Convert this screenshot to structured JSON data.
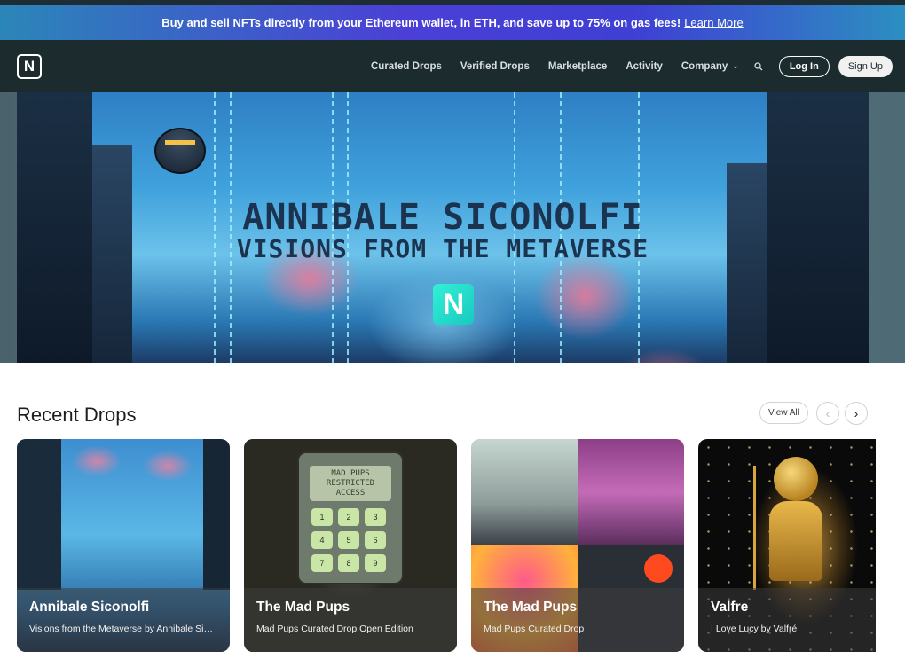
{
  "promo": {
    "text": "Buy and sell NFTs directly from your Ethereum wallet, in ETH, and save up to 75% on gas fees!",
    "link": "Learn More"
  },
  "nav": {
    "logo": "N",
    "links": [
      "Curated Drops",
      "Verified Drops",
      "Marketplace",
      "Activity"
    ],
    "company": "Company",
    "login": "Log In",
    "signup": "Sign Up"
  },
  "hero": {
    "title": "ANNIBALE SICONOLFI",
    "subtitle": "VISIONS FROM THE METAVERSE",
    "logo": "N"
  },
  "recent": {
    "title": "Recent Drops",
    "view_all": "View All",
    "prev": "‹",
    "next": "›",
    "cards": [
      {
        "title": "Annibale Siconolfi",
        "subtitle": "Visions from the Metaverse by Annibale Siconolfi"
      },
      {
        "title": "The Mad Pups",
        "subtitle": "Mad Pups Curated Drop Open Edition"
      },
      {
        "title": "The Mad Pups",
        "subtitle": "Mad Pups Curated Drop"
      },
      {
        "title": "Valfre",
        "subtitle": "I Love Lucy by Valfré"
      }
    ],
    "keypad_screen": "MAD PUPS RESTRICTED ACCESS",
    "keypad_keys": [
      "1",
      "2",
      "3",
      "4",
      "5",
      "6",
      "7",
      "8",
      "9"
    ]
  },
  "colors": {
    "nav_bg": "#1b2b2e",
    "accent": "#18c9c0"
  }
}
